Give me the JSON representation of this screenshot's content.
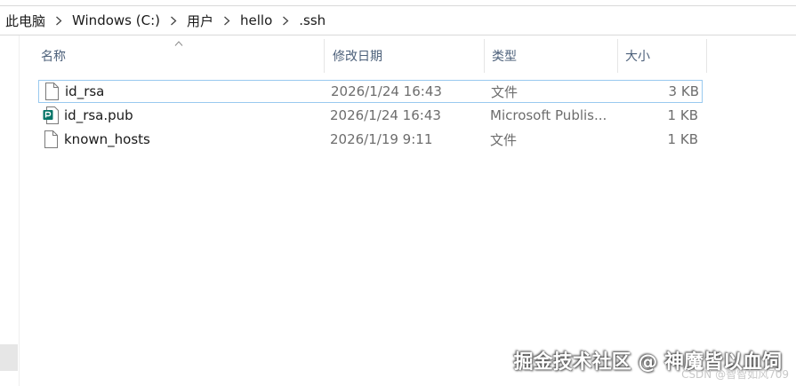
{
  "breadcrumb": [
    "此电脑",
    "Windows (C:)",
    "用户",
    "hello",
    ".ssh"
  ],
  "columns": {
    "name": "名称",
    "date": "修改日期",
    "type": "类型",
    "size": "大小"
  },
  "files": [
    {
      "name": "id_rsa",
      "date": "2026/1/24 16:43",
      "type": "文件",
      "size": "3 KB",
      "icon": "blank-file-icon"
    },
    {
      "name": "id_rsa.pub",
      "date": "2026/1/24 16:43",
      "type": "Microsoft Publis...",
      "size": "1 KB",
      "icon": "publisher-file-icon"
    },
    {
      "name": "known_hosts",
      "date": "2026/1/19 9:11",
      "type": "文件",
      "size": "1 KB",
      "icon": "blank-file-icon"
    }
  ],
  "watermark": {
    "main": "掘金技术社区 @ 神魔皆以血饲",
    "sub": "CSDN @智智如风709"
  },
  "colors": {
    "focus_border": "#99c9ef",
    "publisher_icon": "#077568"
  }
}
